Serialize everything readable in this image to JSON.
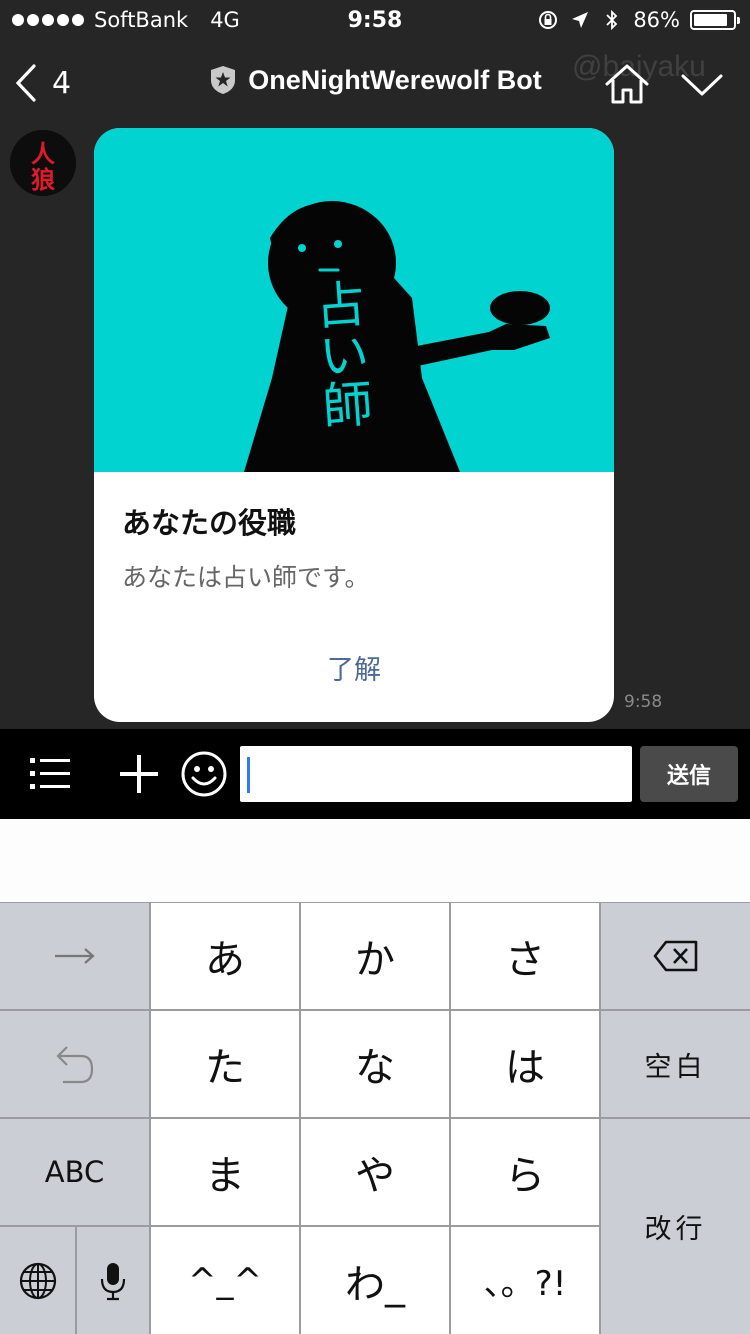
{
  "status_bar": {
    "carrier": "SoftBank",
    "network": "4G",
    "time": "9:58",
    "battery_percent": "86%",
    "battery_level": 0.86
  },
  "header": {
    "back_count": "4",
    "title": "OneNightWerewolf Bot",
    "watermark": "@baiyaku"
  },
  "avatar": {
    "label_top": "人",
    "label_bottom": "狼"
  },
  "message": {
    "hero_caption": "占い師",
    "title": "あなたの役職",
    "text": "あなたは占い師です。",
    "action_label": "了解",
    "time": "9:58"
  },
  "input_bar": {
    "value": "",
    "send_label": "送信"
  },
  "keyboard": {
    "keys": {
      "a": "あ",
      "ka": "か",
      "sa": "さ",
      "ta": "た",
      "na": "な",
      "ha": "は",
      "ma": "ま",
      "ya": "や",
      "ra": "ら",
      "kaomoji": "^_^",
      "wa": "わ_",
      "punct": "、。?!",
      "space": "空白",
      "return": "改行",
      "abc": "ABC"
    }
  },
  "colors": {
    "background": "#262626",
    "hero": "#00d3d0",
    "action": "#4c6a97",
    "caret": "#3478f6"
  }
}
